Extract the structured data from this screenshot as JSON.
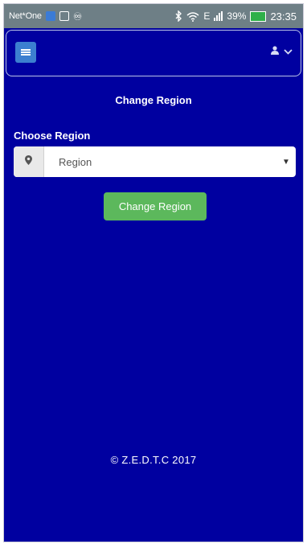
{
  "status_bar": {
    "carrier": "Net*One",
    "network_type": "E",
    "battery_percent": "39%",
    "time": "23:35",
    "icons": [
      "sim-icon",
      "gallery-icon",
      "sync-icon",
      "bluetooth-icon",
      "wifi-icon",
      "signal-icon",
      "battery-icon"
    ]
  },
  "header": {
    "menu_icon": "hamburger-icon",
    "user_icon": "user-icon",
    "dropdown_icon": "chevron-down-icon"
  },
  "page": {
    "title": "Change Region"
  },
  "form": {
    "region_label": "Choose Region",
    "region_select": {
      "icon": "map-marker-icon",
      "selected": "Region"
    },
    "submit_label": "Change Region"
  },
  "footer": {
    "copyright": "© Z.E.D.T.C  2017"
  },
  "colors": {
    "background": "#0000a0",
    "primary_button": "#3c7fd0",
    "success_button": "#5cb85c",
    "status_bar": "#6e7f86"
  }
}
